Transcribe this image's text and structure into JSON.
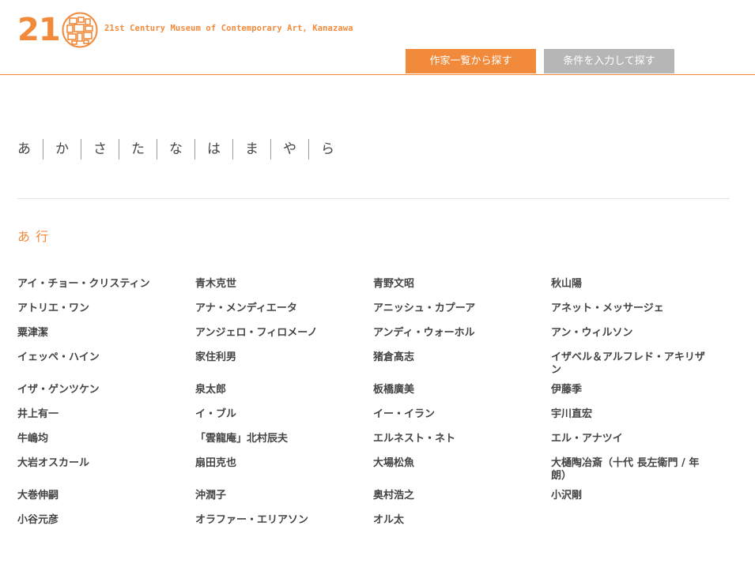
{
  "header": {
    "logo_number": "21",
    "museum_name": "21st Century Museum of Contemporary Art, Kanazawa",
    "tabs": [
      {
        "label": "作家一覧から探す",
        "active": true
      },
      {
        "label": "条件を入力して探す",
        "active": false
      }
    ]
  },
  "kana_index": [
    "あ",
    "か",
    "さ",
    "た",
    "な",
    "は",
    "ま",
    "や",
    "ら"
  ],
  "section": {
    "title": "あ 行",
    "artists": [
      "アイ・チョー・クリスティン",
      "青木克世",
      "青野文昭",
      "秋山陽",
      "アトリエ・ワン",
      "アナ・メンディエータ",
      "アニッシュ・カプーア",
      "アネット・メッサージェ",
      "粟津潔",
      "アンジェロ・フィロメーノ",
      "アンディ・ウォーホル",
      "アン・ウィルソン",
      "イェッペ・ハイン",
      "家住利男",
      "猪倉髙志",
      "イザベル＆アルフレド・アキリザン",
      "イザ・ゲンツケン",
      "泉太郎",
      "板橋廣美",
      "伊藤季",
      "井上有一",
      "イ・ブル",
      "イー・イラン",
      "宇川直宏",
      "牛嶋均",
      "「雲龍庵」北村辰夫",
      "エルネスト・ネト",
      "エル・アナツイ",
      "大岩オスカール",
      "扇田克也",
      "大場松魚",
      "大樋陶冶斎（十代 長左衛門 / 年朗）",
      "大巻伸嗣",
      "沖潤子",
      "奥村浩之",
      "小沢剛",
      "小谷元彦",
      "オラファー・エリアソン",
      "オル太"
    ]
  },
  "colors": {
    "accent": "#f28a3b",
    "inactive_tab": "#b6b6b6",
    "divider": "#e3e3e3"
  }
}
